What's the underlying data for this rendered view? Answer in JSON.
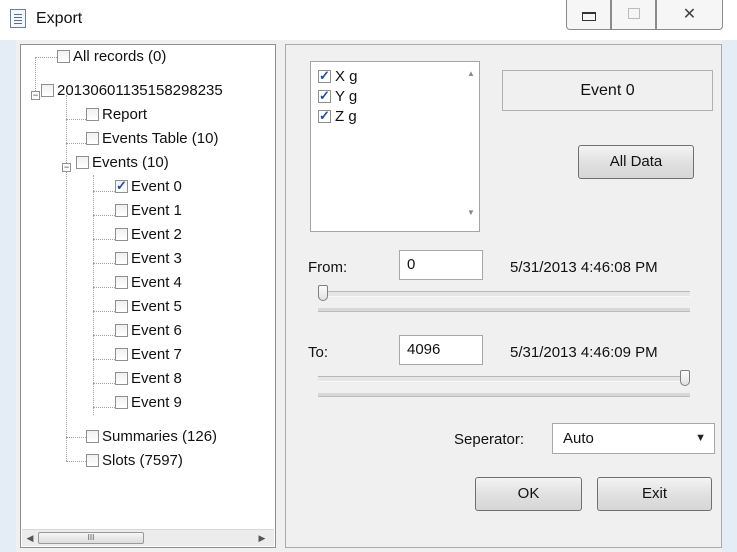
{
  "window": {
    "title": "Export",
    "controls": {
      "minimize": "minimize",
      "maximize": "maximize",
      "close": "✕"
    }
  },
  "tree": {
    "items": [
      {
        "label": "All records (0)",
        "checked": false
      },
      {
        "label": "20130601135158298235",
        "checked": false
      },
      {
        "label": "Report",
        "checked": false
      },
      {
        "label": "Events Table (10)",
        "checked": false
      },
      {
        "label": "Events (10)",
        "checked": false
      },
      {
        "label": "Event 0",
        "checked": true
      },
      {
        "label": "Event 1",
        "checked": false
      },
      {
        "label": "Event 2",
        "checked": false
      },
      {
        "label": "Event 3",
        "checked": false
      },
      {
        "label": "Event 4",
        "checked": false
      },
      {
        "label": "Event 5",
        "checked": false
      },
      {
        "label": "Event 6",
        "checked": false
      },
      {
        "label": "Event 7",
        "checked": false
      },
      {
        "label": "Event 8",
        "checked": false
      },
      {
        "label": "Event 9",
        "checked": false
      },
      {
        "label": "Summaries (126)",
        "checked": false
      },
      {
        "label": "Slots (7597)",
        "checked": false
      }
    ],
    "scroll_thumb_grip": "III"
  },
  "channels": [
    {
      "label": "X g",
      "checked": true
    },
    {
      "label": "Y g",
      "checked": true
    },
    {
      "label": "Z g",
      "checked": true
    }
  ],
  "event_name": "Event 0",
  "all_data_button": "All Data",
  "from": {
    "label": "From:",
    "value": "0",
    "timestamp": "5/31/2013 4:46:08 PM",
    "slider_position": 0
  },
  "to": {
    "label": "To:",
    "value": "4096",
    "timestamp": "5/31/2013 4:46:09 PM",
    "slider_position": 1
  },
  "separator": {
    "label": "Seperator:",
    "value": "Auto"
  },
  "buttons": {
    "ok": "OK",
    "exit": "Exit"
  }
}
